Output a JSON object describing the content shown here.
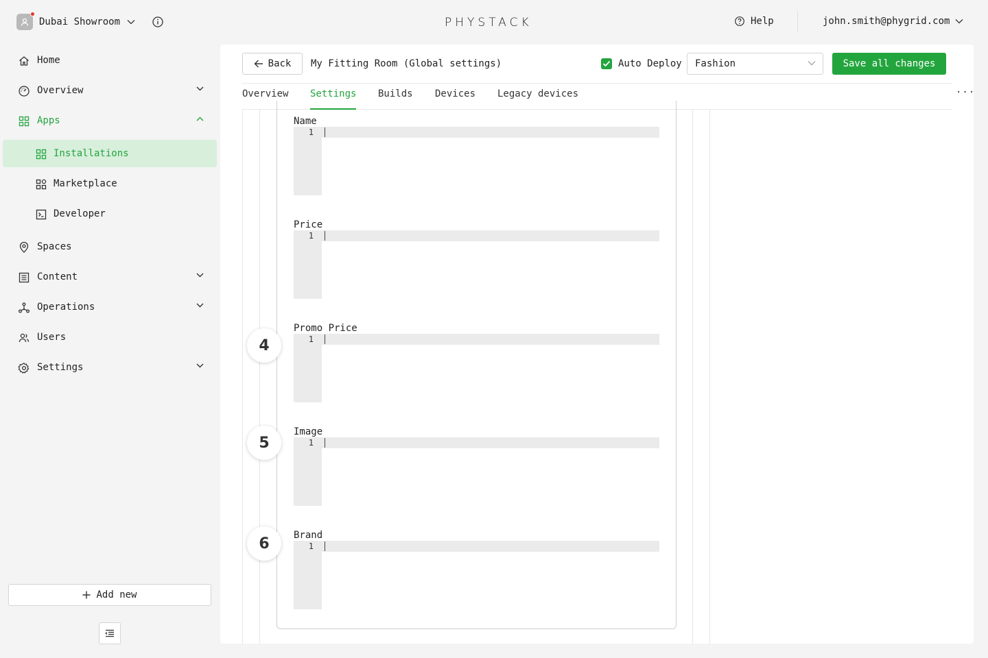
{
  "topbar": {
    "org_name": "Dubai Showroom",
    "logo_text": "PHYSTACK",
    "help_label": "Help",
    "user_email": "john.smith@phygrid.com"
  },
  "sidebar": {
    "items": [
      {
        "label": "Home",
        "icon": "home-icon"
      },
      {
        "label": "Overview",
        "icon": "gauge-icon",
        "expandable": true
      },
      {
        "label": "Apps",
        "icon": "apps-grid-icon",
        "expanded": true
      },
      {
        "label": "Installations",
        "icon": "apps-grid-icon",
        "active": true
      },
      {
        "label": "Marketplace",
        "icon": "marketplace-icon"
      },
      {
        "label": "Developer",
        "icon": "terminal-icon"
      },
      {
        "label": "Spaces",
        "icon": "location-pin-icon"
      },
      {
        "label": "Content",
        "icon": "content-list-icon",
        "expandable": true
      },
      {
        "label": "Operations",
        "icon": "network-icon",
        "expandable": true
      },
      {
        "label": "Users",
        "icon": "users-icon"
      },
      {
        "label": "Settings",
        "icon": "gear-icon",
        "expandable": true
      }
    ],
    "add_new_label": "Add new"
  },
  "header": {
    "back_label": "Back",
    "title": "My Fitting Room (Global settings)",
    "auto_deploy_label": "Auto Deploy",
    "auto_deploy_checked": true,
    "select_value": "Fashion",
    "save_label": "Save all changes"
  },
  "tabs": [
    {
      "label": "Overview"
    },
    {
      "label": "Settings",
      "active": true
    },
    {
      "label": "Builds"
    },
    {
      "label": "Devices"
    },
    {
      "label": "Legacy devices"
    }
  ],
  "more_label": "···",
  "fields": [
    {
      "label": "Name",
      "line_number": "1"
    },
    {
      "label": "Price",
      "line_number": "1"
    },
    {
      "label": "Promo Price",
      "line_number": "1"
    },
    {
      "label": "Image",
      "line_number": "1"
    },
    {
      "label": "Brand",
      "line_number": "1"
    }
  ],
  "steps": [
    "4",
    "5",
    "6"
  ],
  "colors": {
    "accent": "#23a53e",
    "active_bg": "#d8efdc",
    "background": "#f4f4f4"
  }
}
